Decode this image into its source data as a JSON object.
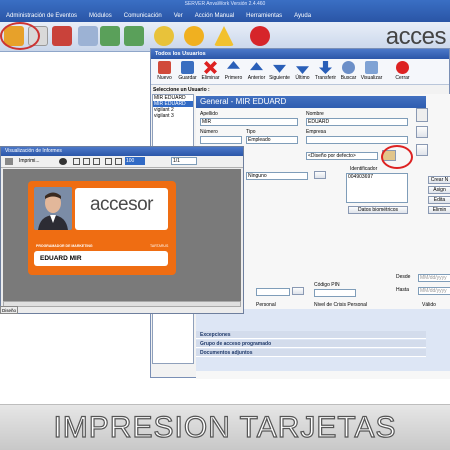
{
  "app_title": "SERVER AnvaWork Versión 2.4.460",
  "menu": [
    "Administración de Eventos",
    "Módulos",
    "Comunicación",
    "Ver",
    "Acción Manual",
    "Herramientas",
    "Ayuda"
  ],
  "brand": "acces",
  "users_window": {
    "title": "Todos los Usuarios",
    "toolbar": [
      "Nuevo",
      "Guardar",
      "Eliminar",
      "Primero",
      "Anterior",
      "Siguiente",
      "Último",
      "Transferir",
      "Buscar",
      "Visualizar",
      "Cerrar"
    ],
    "select_label": "Seleccione un Usuario :",
    "users": [
      "MIR EDUARD",
      "MIR EDUARD",
      "vigilant 2",
      "vigilant 3"
    ],
    "form_title": "General - MIR EDUARD",
    "labels": {
      "apellido": "Apellido",
      "nombre": "Nombre",
      "numero": "Número",
      "tipo": "Tipo",
      "empresa": "Empresa",
      "identificador": "Identificador",
      "codigo_pin": "Código PIN",
      "nivel_crisis": "Nivel de Crisis Personal",
      "desde": "Desde",
      "hasta": "Hasta",
      "personal": "Personal",
      "ningunol": "Ninguno"
    },
    "values": {
      "apellido": "MIR",
      "nombre": "EDUARD",
      "tipo": "Empleado",
      "diseno": "<Diseño por defecto>",
      "identificador": "004903697",
      "nivel": "0",
      "desde_date": "MM/dd/yyyy",
      "hasta_date": "MM/dd/yyyy",
      "valido": "Válido"
    },
    "buttons": {
      "datos_biometricos": "Datos biométricos",
      "crear": "Crear N",
      "asignar": "Asign",
      "editar": "Edita",
      "eliminar": "Elimin"
    },
    "sections": [
      "Excepciones",
      "Grupo de acceso programado",
      "Documentos adjuntos"
    ]
  },
  "report_window": {
    "title": "Visualización de Informes",
    "print_label": "Imprimi...",
    "zoom": "100",
    "page": "1/1"
  },
  "card": {
    "logo": "accesor",
    "subtitle": "PROGRAMADOR DE MARKETING",
    "code": "TARTARUS",
    "name": "EDUARD MIR"
  },
  "report_tab": "Diseño",
  "caption": "IMPRESION TARJETAS",
  "colors": {
    "accent_orange": "#ef6d12",
    "title_blue": "#2f5db0"
  }
}
